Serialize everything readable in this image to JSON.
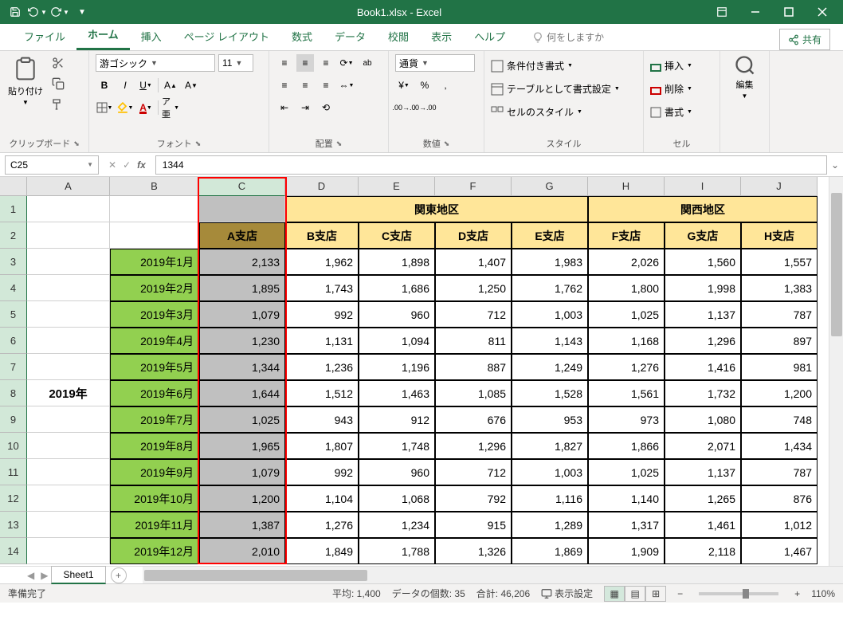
{
  "title": "Book1.xlsx  -  Excel",
  "tabs": [
    "ファイル",
    "ホーム",
    "挿入",
    "ページ レイアウト",
    "数式",
    "データ",
    "校閲",
    "表示",
    "ヘルプ"
  ],
  "active_tab": "ホーム",
  "tell_me": "何をしますか",
  "share": "共有",
  "ribbon": {
    "clipboard": {
      "paste": "貼り付け",
      "label": "クリップボード"
    },
    "font": {
      "name": "游ゴシック",
      "size": "11",
      "label": "フォント"
    },
    "align": {
      "label": "配置"
    },
    "number": {
      "format": "通貨",
      "label": "数値"
    },
    "styles": {
      "cond": "条件付き書式",
      "table": "テーブルとして書式設定",
      "cell": "セルのスタイル",
      "label": "スタイル"
    },
    "cells": {
      "insert": "挿入",
      "delete": "削除",
      "format": "書式",
      "label": "セル"
    },
    "editing": {
      "label": "編集"
    }
  },
  "name_box": "C25",
  "formula": "1344",
  "col_widths": {
    "A": 104,
    "B": 112,
    "C": 108,
    "D": 92,
    "E": 96,
    "F": 96,
    "G": 96,
    "H": 96,
    "I": 96,
    "J": 96
  },
  "columns": [
    "A",
    "B",
    "C",
    "D",
    "E",
    "F",
    "G",
    "H",
    "I",
    "J"
  ],
  "row_numbers": [
    1,
    2,
    3,
    4,
    5,
    6,
    7,
    8,
    9,
    10,
    11,
    12,
    13,
    14
  ],
  "regions": {
    "kanto": "関東地区",
    "kansai": "関西地区"
  },
  "stores": [
    "A支店",
    "B支店",
    "C支店",
    "D支店",
    "E支店",
    "F支店",
    "G支店",
    "H支店"
  ],
  "year_label": "2019年",
  "months": [
    "2019年1月",
    "2019年2月",
    "2019年3月",
    "2019年4月",
    "2019年5月",
    "2019年6月",
    "2019年7月",
    "2019年8月",
    "2019年9月",
    "2019年10月",
    "2019年11月",
    "2019年12月"
  ],
  "data": [
    [
      2133,
      1962,
      1898,
      1407,
      1983,
      2026,
      1560,
      1557
    ],
    [
      1895,
      1743,
      1686,
      1250,
      1762,
      1800,
      1998,
      1383
    ],
    [
      1079,
      992,
      960,
      712,
      1003,
      1025,
      1137,
      787
    ],
    [
      1230,
      1131,
      1094,
      811,
      1143,
      1168,
      1296,
      897
    ],
    [
      1344,
      1236,
      1196,
      887,
      1249,
      1276,
      1416,
      981
    ],
    [
      1644,
      1512,
      1463,
      1085,
      1528,
      1561,
      1732,
      1200
    ],
    [
      1025,
      943,
      912,
      676,
      953,
      973,
      1080,
      748
    ],
    [
      1965,
      1807,
      1748,
      1296,
      1827,
      1866,
      2071,
      1434
    ],
    [
      1079,
      992,
      960,
      712,
      1003,
      1025,
      1137,
      787
    ],
    [
      1200,
      1104,
      1068,
      792,
      1116,
      1140,
      1265,
      876
    ],
    [
      1387,
      1276,
      1234,
      915,
      1289,
      1317,
      1461,
      1012
    ],
    [
      2010,
      1849,
      1788,
      1326,
      1869,
      1909,
      2118,
      1467
    ]
  ],
  "sheet_tab": "Sheet1",
  "status": {
    "ready": "準備完了",
    "avg_l": "平均:",
    "avg": "1,400",
    "cnt_l": "データの個数:",
    "cnt": "35",
    "sum_l": "合計:",
    "sum": "46,206",
    "disp": "表示設定",
    "zoom": "110%"
  }
}
